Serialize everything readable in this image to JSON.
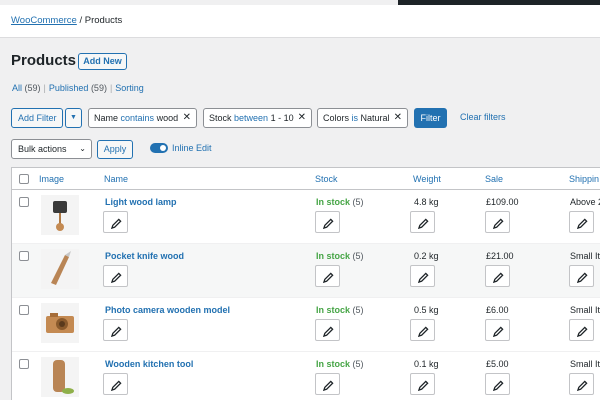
{
  "breadcrumb": {
    "root": "WooCommerce",
    "separator": "/",
    "current": "Products"
  },
  "page": {
    "title": "Products",
    "add_new": "Add New"
  },
  "views": [
    {
      "label": "All",
      "count": "(59)"
    },
    {
      "label": "Published",
      "count": "(59)"
    },
    {
      "label": "Sorting",
      "count": ""
    }
  ],
  "filters": {
    "add_filter": "Add Filter",
    "chips": [
      {
        "field": "Name",
        "op": "contains",
        "value": "wood"
      },
      {
        "field": "Stock",
        "op": "between",
        "value": "1 - 10"
      },
      {
        "field": "Colors",
        "op": "is",
        "value": "Natural"
      }
    ],
    "filter_button": "Filter",
    "clear": "Clear filters"
  },
  "bulk": {
    "label": "Bulk actions",
    "apply": "Apply",
    "inline_edit": "Inline Edit",
    "inline_edit_on": true
  },
  "table": {
    "columns": [
      "Image",
      "Name",
      "Stock",
      "Weight",
      "Sale",
      "Shippin"
    ],
    "rows": [
      {
        "name": "Light wood lamp",
        "stock": "In stock",
        "qty": "(5)",
        "weight": "4.8 kg",
        "sale": "£109.00",
        "shipping": "Above 2"
      },
      {
        "name": "Pocket knife wood",
        "stock": "In stock",
        "qty": "(5)",
        "weight": "0.2 kg",
        "sale": "£21.00",
        "shipping": "Small Ite"
      },
      {
        "name": "Photo camera wooden model",
        "stock": "In stock",
        "qty": "(5)",
        "weight": "0.5 kg",
        "sale": "£6.00",
        "shipping": "Small Ite"
      },
      {
        "name": "Wooden kitchen tool",
        "stock": "In stock",
        "qty": "(5)",
        "weight": "0.1 kg",
        "sale": "£5.00",
        "shipping": "Small Ite"
      }
    ]
  },
  "colors": {
    "link": "#2271b1",
    "in_stock": "#46a546",
    "dark": "#1d2327"
  },
  "icons": [
    "pencil-icon",
    "close-icon",
    "chevron-down-icon",
    "toggle-icon"
  ]
}
